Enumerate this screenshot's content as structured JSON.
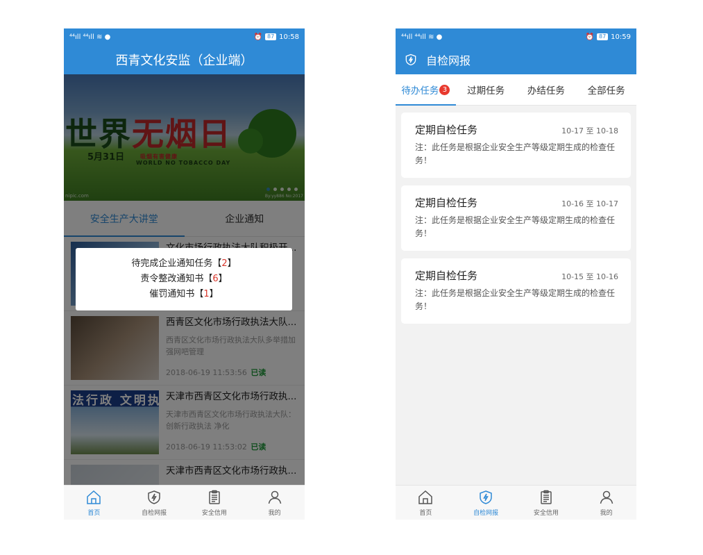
{
  "status_left": {
    "signal_text": "⁴⁴.ıll ⁴⁴.ıll ≈ ●",
    "time": "10:58",
    "battery": "87"
  },
  "status_right": {
    "time": "10:59",
    "battery": "87"
  },
  "home": {
    "title": "西青文化安监（企业端）",
    "banner": {
      "headline_a": "世界",
      "headline_b": "无烟日",
      "date": "5月31日",
      "sub_red": "吸烟有害健康",
      "sub_en": "WORLD NO TOBACCO DAY",
      "watermark_left": "nipic.com",
      "watermark_right": "By:yy886 No:2017"
    },
    "tabs": [
      {
        "label": "安全生产大讲堂",
        "active": true
      },
      {
        "label": "企业通知",
        "active": false
      }
    ],
    "news": [
      {
        "title": "文化市场行政执法大队积极开...",
        "summary": "",
        "date": "",
        "read": ""
      },
      {
        "title": "西青区文化市场行政执法大队...",
        "summary": "西青区文化市场行政执法大队多举措加强网吧管理",
        "date": "2018-06-19 11:53:56",
        "read": "已读"
      },
      {
        "title": "天津市西青区文化市场行政执...",
        "summary": "天津市西青区文化市场行政执法大队：创新行政执法 净化",
        "date": "2018-06-19 11:53:02",
        "read": "已读",
        "slogan": "法行政 文明执"
      },
      {
        "title": "天津市西青区文化市场行政执...",
        "summary": "",
        "date": "",
        "read": ""
      }
    ],
    "dialog": {
      "line1_text": "待完成企业通知任务【",
      "line1_num": "2",
      "line2_text": "责令整改通知书【",
      "line2_num": "6",
      "line3_text": "催罚通知书【",
      "line3_num": "1",
      "close_bracket": "】"
    }
  },
  "selfcheck": {
    "title": "自检网报",
    "tabs": [
      {
        "label": "待办任务",
        "badge": "3",
        "active": true
      },
      {
        "label": "过期任务",
        "active": false
      },
      {
        "label": "办结任务",
        "active": false
      },
      {
        "label": "全部任务",
        "active": false
      }
    ],
    "tasks": [
      {
        "title": "定期自检任务",
        "date": "10-17 至 10-18",
        "note": "注：此任务是根据企业安全生产等级定期生成的检查任务！"
      },
      {
        "title": "定期自检任务",
        "date": "10-16 至 10-17",
        "note": "注：此任务是根据企业安全生产等级定期生成的检查任务！"
      },
      {
        "title": "定期自检任务",
        "date": "10-15 至 10-16",
        "note": "注：此任务是根据企业安全生产等级定期生成的检查任务！"
      }
    ]
  },
  "bottom_nav": [
    {
      "label": "首页",
      "icon": "home-icon"
    },
    {
      "label": "自检网报",
      "icon": "shield-bolt-icon"
    },
    {
      "label": "安全信用",
      "icon": "clipboard-icon"
    },
    {
      "label": "我的",
      "icon": "user-icon"
    }
  ],
  "colors": {
    "primary": "#2f8ad6",
    "badge": "#e8392e",
    "read": "#1f9a3a",
    "dialog_num": "#d9362b"
  }
}
